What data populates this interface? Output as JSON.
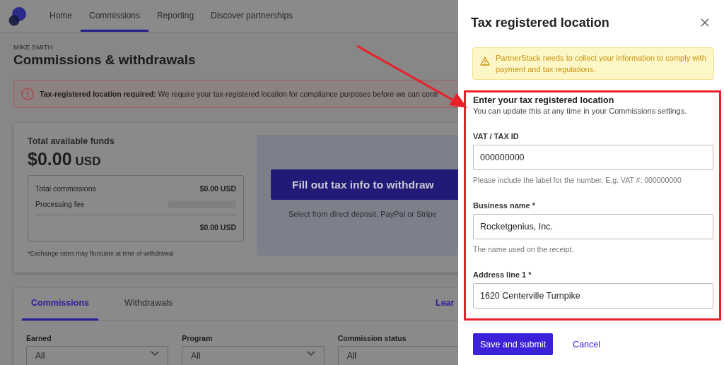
{
  "nav": {
    "tabs": [
      {
        "label": "Home",
        "selected": false
      },
      {
        "label": "Commissions",
        "selected": true
      },
      {
        "label": "Reporting",
        "selected": false
      },
      {
        "label": "Discover partnerships",
        "selected": false
      }
    ]
  },
  "header": {
    "account": "MIKE SMITH",
    "title": "Commissions & withdrawals"
  },
  "alert": {
    "message": "**Tax-registered location required:** We require your tax-registered location for compliance purposes before we can conti"
  },
  "funds": {
    "label": "Total available funds",
    "amount": "$0.00",
    "currency": "USD",
    "rows": [
      {
        "kind": "value",
        "label": "Total commissions",
        "value": "$0.00 USD"
      },
      {
        "kind": "placeholder",
        "label": "Processing fee"
      }
    ],
    "total": "$0.00 USD",
    "note": "*Exchange rates may fluctuate at time of withdrawal"
  },
  "withdraw": {
    "button": "Fill out tax info to withdraw",
    "hint": "Select from direct deposit, PayPal or Stripe"
  },
  "table_tabs": [
    {
      "label": "Commissions",
      "selected": true
    },
    {
      "label": "Withdrawals",
      "selected": false
    }
  ],
  "learn_link": "Lear",
  "filters": [
    {
      "label": "Earned",
      "value": "All"
    },
    {
      "label": "Program",
      "value": "All"
    },
    {
      "label": "Commission status",
      "value": "All"
    }
  ],
  "drawer": {
    "title": "Tax registered location",
    "warning": "PartnerStack needs to collect your information to comply with payment and tax regulations.",
    "section_title": "Enter your tax registered location",
    "section_subtitle": "You can update this at any time in your Commissions settings.",
    "fields": [
      {
        "label": "VAT / TAX ID",
        "value": "000000000",
        "help": "Please include the label for the number. E.g. VAT #: 000000000"
      },
      {
        "label": "Business name *",
        "value": "Rocketgenius, Inc.",
        "help": "The name used on the receipt."
      },
      {
        "label": "Address line 1 *",
        "value": "1620 Centerville Turnpike"
      }
    ],
    "save": "Save and submit",
    "cancel": "Cancel"
  }
}
